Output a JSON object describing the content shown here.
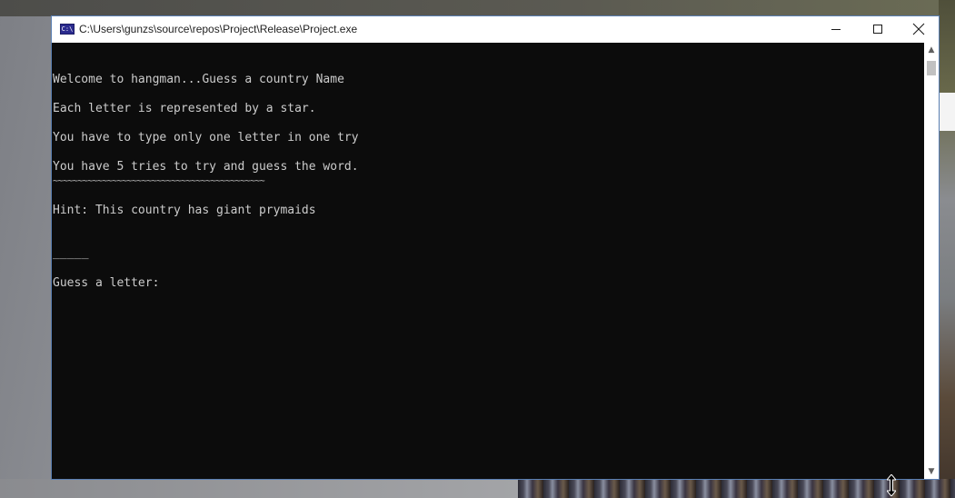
{
  "window": {
    "title": "C:\\Users\\gunzs\\source\\repos\\Project\\Release\\Project.exe",
    "icon": "console-app-icon",
    "icon_text": "C:\\",
    "controls": [
      "minimize-icon",
      "maximize-icon",
      "close-icon"
    ]
  },
  "console": {
    "lines": [
      "Welcome to hangman...Guess a country Name",
      "Each letter is represented by a star.",
      "You have to type only one letter in one try",
      "You have 5 tries to try and guess the word.",
      "~~~~~~~~~~~~~~~~~~~~~~~~~~~~~~~~~~~~~~~~~~~",
      "Hint: This country has giant prymaids",
      "_____",
      "Guess a letter: "
    ]
  },
  "colors": {
    "console_bg": "#0c0c0c",
    "console_text": "#cccccc",
    "titlebar_bg": "#ffffff",
    "window_border": "#5a7fb3"
  },
  "cursor": "vertical-resize-cursor"
}
